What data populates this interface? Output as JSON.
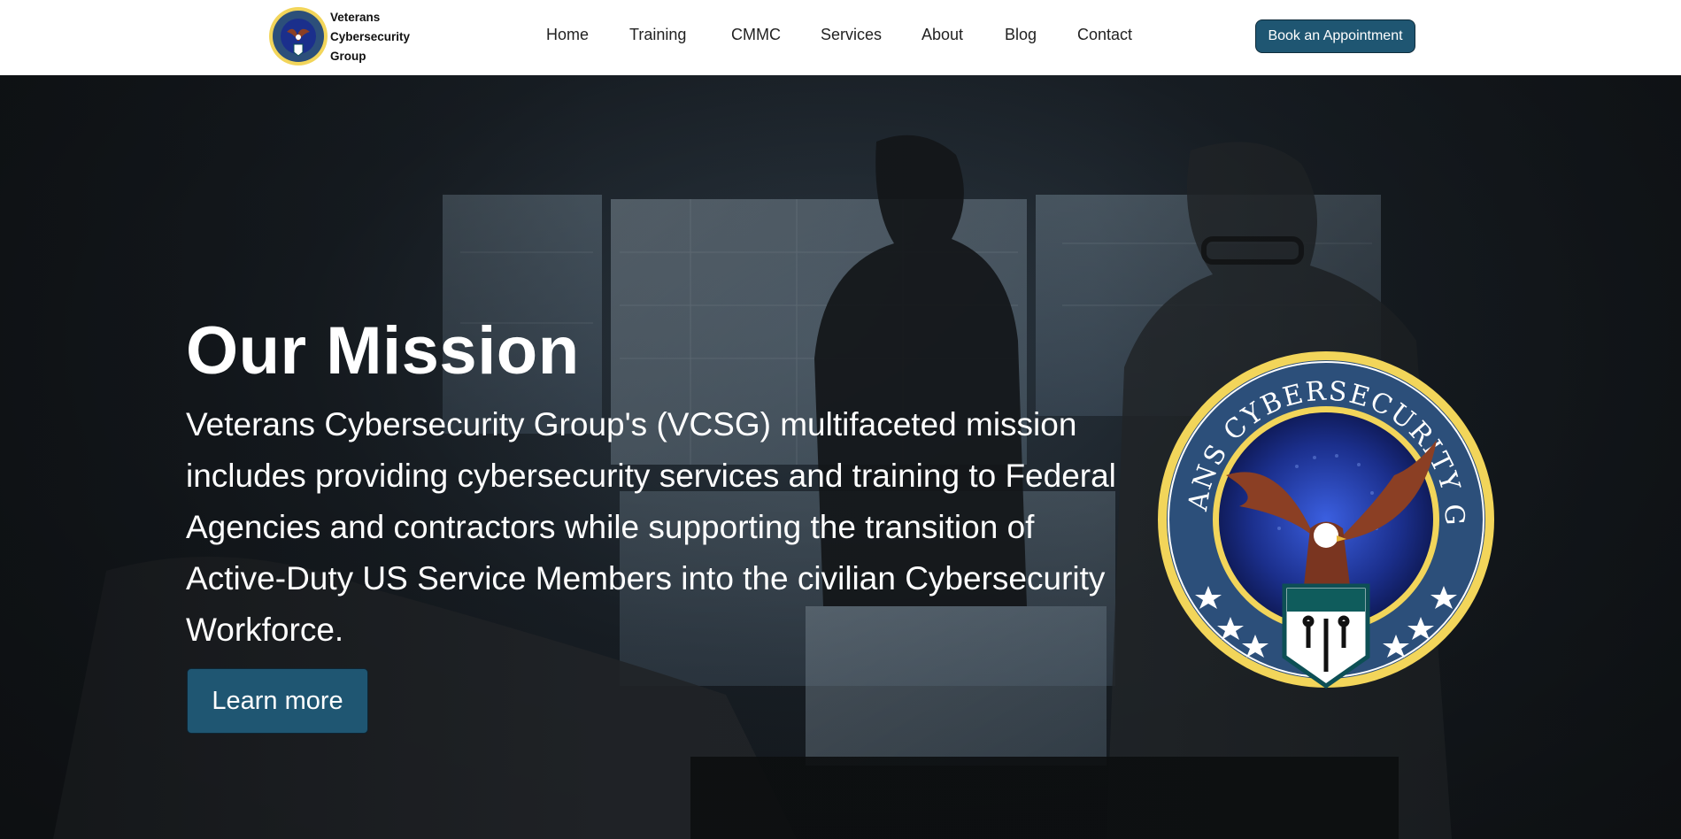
{
  "header": {
    "brand_lines": [
      "Veterans",
      "Cybersecurity",
      "Group"
    ],
    "nav": [
      {
        "label": "Home"
      },
      {
        "label": "Training"
      },
      {
        "label": "CMMC"
      },
      {
        "label": "Services"
      },
      {
        "label": "About"
      },
      {
        "label": "Blog"
      },
      {
        "label": "Contact"
      }
    ],
    "cta_label": "Book an Appointment"
  },
  "hero": {
    "title": "Our Mission",
    "text": "Veterans Cybersecurity Group's (VCSG) multifaceted mission includes providing cybersecurity services and training to Federal Agencies and contractors while supporting the transition of Active-Duty US Service Members into the civilian Cybersecurity Workforce.",
    "button_label": "Learn more",
    "seal_text": "VETERANS CYBERSECURITY GROUP"
  },
  "colors": {
    "primary": "#1f5672",
    "seal_gold": "#f2d55a",
    "seal_blue": "#2c4f7a",
    "seal_inner": "#1b2f8c",
    "eagle": "#8b3f24"
  },
  "icons": [
    "logo-seal-icon",
    "eagle-icon",
    "star-icon",
    "shield-icon"
  ]
}
